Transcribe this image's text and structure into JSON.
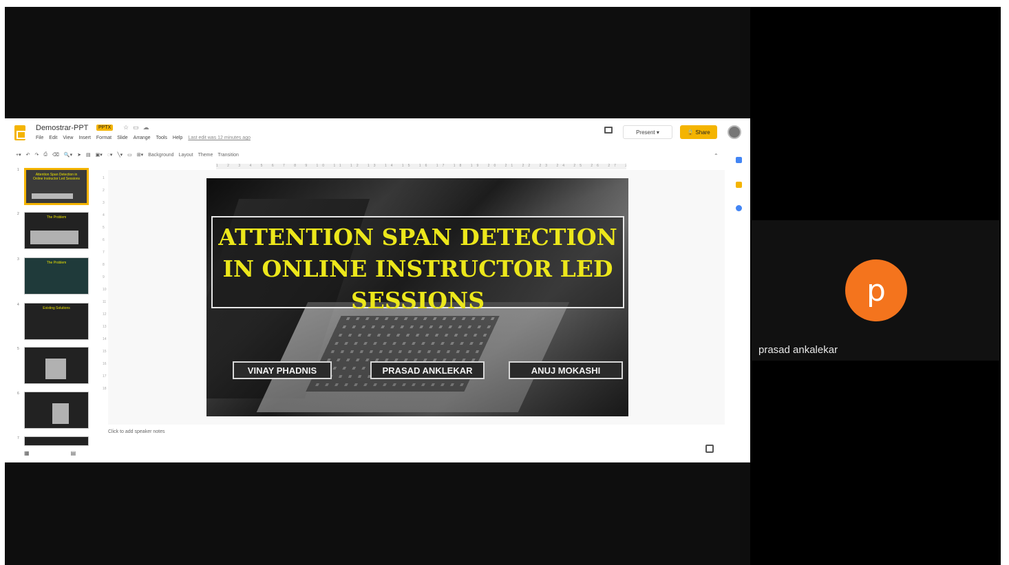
{
  "slides_app": {
    "title": "Demostrar-PPT",
    "badge": "PPTX",
    "menu": [
      "File",
      "Edit",
      "View",
      "Insert",
      "Format",
      "Slide",
      "Arrange",
      "Tools",
      "Help"
    ],
    "last_edit": "Last edit was 12 minutes ago",
    "present_label": "Present",
    "share_label": "Share",
    "toolbar_items": [
      "Background",
      "Layout",
      "Theme",
      "Transition"
    ],
    "notes_placeholder": "Click to add speaker notes"
  },
  "slide": {
    "title": "ATTENTION SPAN DETECTION IN ONLINE INSTRUCTOR LED SESSIONS",
    "names": [
      "VINAY PHADNIS",
      "PRASAD ANKLEKAR",
      "ANUJ MOKASHI"
    ]
  },
  "thumbnails": [
    {
      "num": "1",
      "text": "Attention Span Detection in Online Instructor Led Sessions"
    },
    {
      "num": "2",
      "text": "The Problem"
    },
    {
      "num": "3",
      "text": "The Problem"
    },
    {
      "num": "4",
      "text": "Existing Solutions"
    },
    {
      "num": "5",
      "text": ""
    },
    {
      "num": "6",
      "text": ""
    },
    {
      "num": "7",
      "text": ""
    }
  ],
  "participant": {
    "initial": "p",
    "name": "prasad ankalekar",
    "avatar_color": "#f4741d"
  },
  "colors": {
    "accent": "#f4b400",
    "slide_title": "#ece71b"
  }
}
